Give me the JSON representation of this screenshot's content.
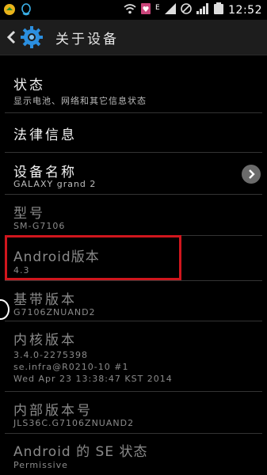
{
  "status_bar": {
    "time": "12:52",
    "extra": "E"
  },
  "action_bar": {
    "title": "关于设备"
  },
  "items": [
    {
      "title": "状态",
      "subtitle": "显示电池、网络和其它信息状态"
    },
    {
      "title": "法律信息"
    },
    {
      "title": "设备名称",
      "subtitle": "GALAXY grand 2"
    },
    {
      "title": "型号",
      "subtitle": "SM-G7106"
    },
    {
      "title": "Android版本",
      "subtitle": "4.3"
    },
    {
      "title": "基带版本",
      "subtitle": "G7106ZNUAND2"
    },
    {
      "title": "内核版本",
      "lines": [
        "3.4.0-2275398",
        "se.infra@R0210-10 #1",
        "Wed Apr 23 13:38:47 KST 2014"
      ]
    },
    {
      "title": "内部版本号",
      "subtitle": "JLS36C.G7106ZNUAND2"
    },
    {
      "title": "Android 的 SE 状态",
      "subtitle": "Permissive"
    }
  ]
}
